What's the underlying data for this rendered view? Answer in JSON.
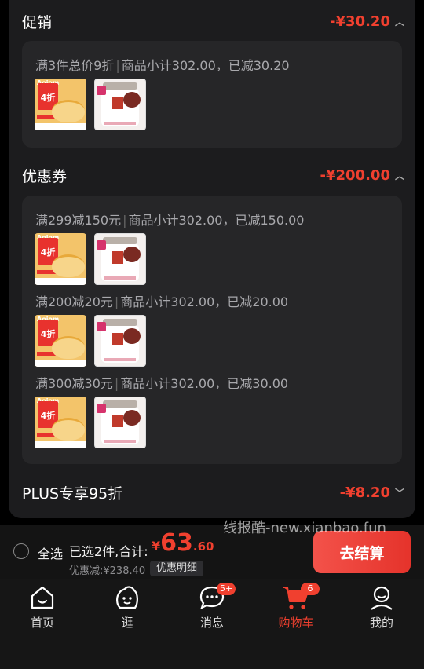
{
  "promotion": {
    "title": "促销",
    "amount": "-¥30.20",
    "rule_main": "满3件总价9折",
    "rule_detail": "商品小计302.00，已减30.20"
  },
  "coupons": {
    "title": "优惠券",
    "amount": "-¥200.00",
    "items": [
      {
        "rule_main": "满299减150元",
        "rule_detail": "商品小计302.00，已减150.00"
      },
      {
        "rule_main": "满200减20元",
        "rule_detail": "商品小计302.00，已减20.00"
      },
      {
        "rule_main": "满300减30元",
        "rule_detail": "商品小计302.00，已减30.00"
      }
    ]
  },
  "plus": {
    "title": "PLUS专享95折",
    "amount": "-¥8.20"
  },
  "product_thumbs": {
    "fries_logo": "Aojom",
    "fries_badge": "4折"
  },
  "watermark": "线报酷-new.xianbao.fun",
  "summary": {
    "select_all": "全选",
    "selected_label": "已选2件,合计:",
    "currency": "¥",
    "total_int": "63",
    "total_dec": ".60",
    "saved": "优惠减:¥238.40",
    "detail_button": "优惠明细",
    "checkout_button": "去结算"
  },
  "tabbar": {
    "items": [
      {
        "label": "首页",
        "icon": "home-icon"
      },
      {
        "label": "逛",
        "icon": "stroll-icon"
      },
      {
        "label": "消息",
        "icon": "message-icon",
        "badge": "5+"
      },
      {
        "label": "购物车",
        "icon": "cart-icon",
        "badge": "6"
      },
      {
        "label": "我的",
        "icon": "profile-icon"
      }
    ],
    "active": "购物车"
  },
  "colors": {
    "accent": "#f0402f",
    "panel": "#1c1c1e",
    "box": "#262628"
  }
}
